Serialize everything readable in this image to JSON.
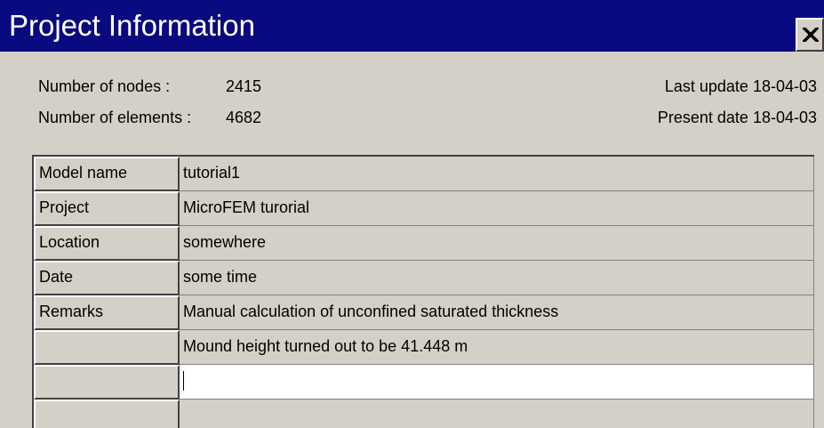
{
  "window": {
    "title": "Project Information"
  },
  "summary": {
    "nodes_label": "Number of nodes :",
    "nodes_value": "2415",
    "elements_label": "Number of elements :",
    "elements_value": "4682",
    "last_update": "Last update 18-04-03",
    "present_date": "Present date 18-04-03"
  },
  "grid": {
    "rows": [
      {
        "label": "Model name",
        "value": "tutorial1"
      },
      {
        "label": "Project",
        "value": "MicroFEM turorial"
      },
      {
        "label": "Location",
        "value": "somewhere"
      },
      {
        "label": "Date",
        "value": "some time"
      },
      {
        "label": "Remarks",
        "value": "Manual calculation of unconfined saturated thickness"
      },
      {
        "label": "",
        "value": "Mound height turned out to be 41.448 m"
      },
      {
        "label": "",
        "value": ""
      },
      {
        "label": "",
        "value": ""
      }
    ]
  }
}
